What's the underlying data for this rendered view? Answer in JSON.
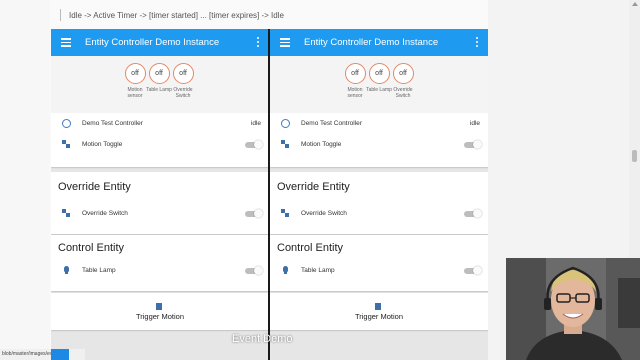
{
  "breadcrumb": "Idle -> Active Timer -> [timer started] ... [timer expires] -> Idle",
  "colors": {
    "app_bar": "#1e9bf0",
    "badge_ring": "#e08a6a",
    "icon": "#3e6fa8",
    "divider": "#1a1a1a"
  },
  "instances": [
    {
      "title": "Entity Controller Demo Instance",
      "badges": [
        {
          "state": "off",
          "label": "Motion sensor"
        },
        {
          "state": "off",
          "label": "Table Lamp"
        },
        {
          "state": "off",
          "label": "Override Switch"
        }
      ],
      "controller": {
        "name": "Demo Test Controller",
        "state": "idle"
      },
      "motion_toggle": {
        "name": "Motion Toggle",
        "icon": "switch-icon",
        "on": false
      },
      "override": {
        "title": "Override Entity",
        "item": "Override Switch",
        "icon": "switch-icon",
        "on": false
      },
      "control": {
        "title": "Control Entity",
        "item": "Table Lamp",
        "icon": "lightbulb-icon",
        "on": false
      },
      "trigger": {
        "label": "Trigger Motion",
        "icon": "file-icon"
      }
    },
    {
      "title": "Entity Controller Demo Instance",
      "badges": [
        {
          "state": "off",
          "label": "Motion sensor"
        },
        {
          "state": "off",
          "label": "Table Lamp"
        },
        {
          "state": "off",
          "label": "Override Switch"
        }
      ],
      "controller": {
        "name": "Demo Test Controller",
        "state": "idle"
      },
      "motion_toggle": {
        "name": "Motion Toggle",
        "icon": "switch-icon",
        "on": false
      },
      "override": {
        "title": "Override Entity",
        "item": "Override Switch",
        "icon": "switch-icon",
        "on": false
      },
      "control": {
        "title": "Control Entity",
        "item": "Table Lamp",
        "icon": "lightbulb-icon",
        "on": false
      },
      "trigger": {
        "label": "Trigger Motion",
        "icon": "file-icon"
      }
    }
  ],
  "overlay_caption": "Event Demo",
  "status_url": "blob/master/images/events.gif"
}
